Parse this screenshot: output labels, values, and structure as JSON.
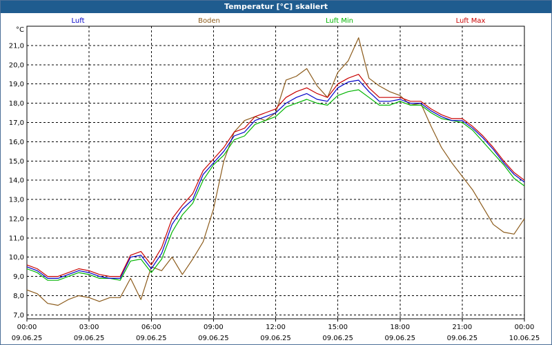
{
  "window": {
    "title": "Temperatur [°C] skaliert"
  },
  "chart_data": {
    "type": "line",
    "title": "Temperatur [°C] skaliert",
    "ylabel": "°C",
    "xlabel": "",
    "ylim": [
      6.8,
      22.0
    ],
    "y_ticks": [
      "7,0",
      "8,0",
      "9,0",
      "10,0",
      "11,0",
      "12,0",
      "13,0",
      "14,0",
      "15,0",
      "16,0",
      "17,0",
      "18,0",
      "19,0",
      "20,0",
      "21,0"
    ],
    "x_ticks": [
      {
        "time": "00:00",
        "date": "09.06.25"
      },
      {
        "time": "03:00",
        "date": "09.06.25"
      },
      {
        "time": "06:00",
        "date": "09.06.25"
      },
      {
        "time": "09:00",
        "date": "09.06.25"
      },
      {
        "time": "12:00",
        "date": "09.06.25"
      },
      {
        "time": "15:00",
        "date": "09.06.25"
      },
      {
        "time": "18:00",
        "date": "09.06.25"
      },
      {
        "time": "21:00",
        "date": "09.06.25"
      },
      {
        "time": "00:00",
        "date": "10.06.25"
      }
    ],
    "grid": true,
    "legend_position": "top",
    "series": [
      {
        "name": "Luft",
        "color": "#0000c8",
        "x": [
          0,
          0.5,
          1,
          1.5,
          2,
          2.5,
          3,
          3.5,
          4,
          4.5,
          5,
          5.5,
          6,
          6.5,
          7,
          7.5,
          8,
          8.5,
          9,
          9.5,
          10,
          10.5,
          11,
          11.5,
          12,
          12.5,
          13,
          13.5,
          14,
          14.5,
          15,
          15.5,
          16,
          16.5,
          17,
          17.5,
          18,
          18.5,
          19,
          19.5,
          20,
          20.5,
          21,
          21.5,
          22,
          22.5,
          23,
          23.5,
          24
        ],
        "values": [
          9.5,
          9.3,
          8.9,
          8.9,
          9.1,
          9.3,
          9.2,
          9.0,
          8.9,
          8.9,
          10.0,
          10.1,
          9.4,
          10.2,
          11.7,
          12.5,
          13.0,
          14.3,
          14.9,
          15.5,
          16.3,
          16.5,
          17.1,
          17.3,
          17.5,
          18.0,
          18.3,
          18.5,
          18.2,
          18.1,
          18.8,
          19.1,
          19.2,
          18.6,
          18.1,
          18.1,
          18.2,
          18.0,
          18.0,
          17.6,
          17.3,
          17.1,
          17.1,
          16.7,
          16.2,
          15.6,
          14.9,
          14.3,
          13.9
        ]
      },
      {
        "name": "Boden",
        "color": "#8b5a1a",
        "x": [
          0,
          0.5,
          1,
          1.5,
          2,
          2.5,
          3,
          3.5,
          4,
          4.5,
          5,
          5.5,
          6,
          6.5,
          7,
          7.5,
          8,
          8.5,
          9,
          9.5,
          10,
          10.5,
          11,
          11.5,
          12,
          12.5,
          13,
          13.5,
          14,
          14.5,
          15,
          15.5,
          16,
          16.5,
          17,
          17.5,
          18,
          18.5,
          19,
          19.5,
          20,
          20.5,
          21,
          21.5,
          22,
          22.5,
          23,
          23.5,
          24
        ],
        "values": [
          8.3,
          8.1,
          7.6,
          7.5,
          7.8,
          8.0,
          7.9,
          7.7,
          7.9,
          7.9,
          8.9,
          7.8,
          9.5,
          9.3,
          10.0,
          9.1,
          9.9,
          10.8,
          12.5,
          15.0,
          16.5,
          17.1,
          17.3,
          17.1,
          17.5,
          19.2,
          19.4,
          19.8,
          18.9,
          18.3,
          19.6,
          20.2,
          21.4,
          19.3,
          18.9,
          18.6,
          18.4,
          17.9,
          18.0,
          16.8,
          15.7,
          14.9,
          14.2,
          13.5,
          12.6,
          11.7,
          11.3,
          11.2,
          12.0
        ]
      },
      {
        "name": "Luft Min",
        "color": "#00b400",
        "x": [
          0,
          0.5,
          1,
          1.5,
          2,
          2.5,
          3,
          3.5,
          4,
          4.5,
          5,
          5.5,
          6,
          6.5,
          7,
          7.5,
          8,
          8.5,
          9,
          9.5,
          10,
          10.5,
          11,
          11.5,
          12,
          12.5,
          13,
          13.5,
          14,
          14.5,
          15,
          15.5,
          16,
          16.5,
          17,
          17.5,
          18,
          18.5,
          19,
          19.5,
          20,
          20.5,
          21,
          21.5,
          22,
          22.5,
          23,
          23.5,
          24
        ],
        "values": [
          9.4,
          9.2,
          8.8,
          8.8,
          9.0,
          9.2,
          9.1,
          8.9,
          8.9,
          8.8,
          9.8,
          9.9,
          9.2,
          9.9,
          11.3,
          12.2,
          12.8,
          14.0,
          14.8,
          15.3,
          16.1,
          16.3,
          16.9,
          17.1,
          17.3,
          17.8,
          18.0,
          18.2,
          18.0,
          17.9,
          18.4,
          18.6,
          18.7,
          18.3,
          17.9,
          17.9,
          18.1,
          17.9,
          17.9,
          17.5,
          17.2,
          17.1,
          17.0,
          16.6,
          16.0,
          15.4,
          14.8,
          14.1,
          13.7
        ]
      },
      {
        "name": "Luft Max",
        "color": "#c80000",
        "x": [
          0,
          0.5,
          1,
          1.5,
          2,
          2.5,
          3,
          3.5,
          4,
          4.5,
          5,
          5.5,
          6,
          6.5,
          7,
          7.5,
          8,
          8.5,
          9,
          9.5,
          10,
          10.5,
          11,
          11.5,
          12,
          12.5,
          13,
          13.5,
          14,
          14.5,
          15,
          15.5,
          16,
          16.5,
          17,
          17.5,
          18,
          18.5,
          19,
          19.5,
          20,
          20.5,
          21,
          21.5,
          22,
          22.5,
          23,
          23.5,
          24
        ],
        "values": [
          9.6,
          9.4,
          9.0,
          9.0,
          9.2,
          9.4,
          9.3,
          9.1,
          9.0,
          9.0,
          10.1,
          10.3,
          9.6,
          10.5,
          12.0,
          12.7,
          13.3,
          14.5,
          15.1,
          15.7,
          16.5,
          16.7,
          17.3,
          17.5,
          17.7,
          18.3,
          18.6,
          18.8,
          18.5,
          18.3,
          19.0,
          19.3,
          19.5,
          18.8,
          18.3,
          18.3,
          18.3,
          18.1,
          18.1,
          17.7,
          17.4,
          17.2,
          17.2,
          16.8,
          16.3,
          15.7,
          15.0,
          14.4,
          14.0
        ]
      }
    ]
  }
}
